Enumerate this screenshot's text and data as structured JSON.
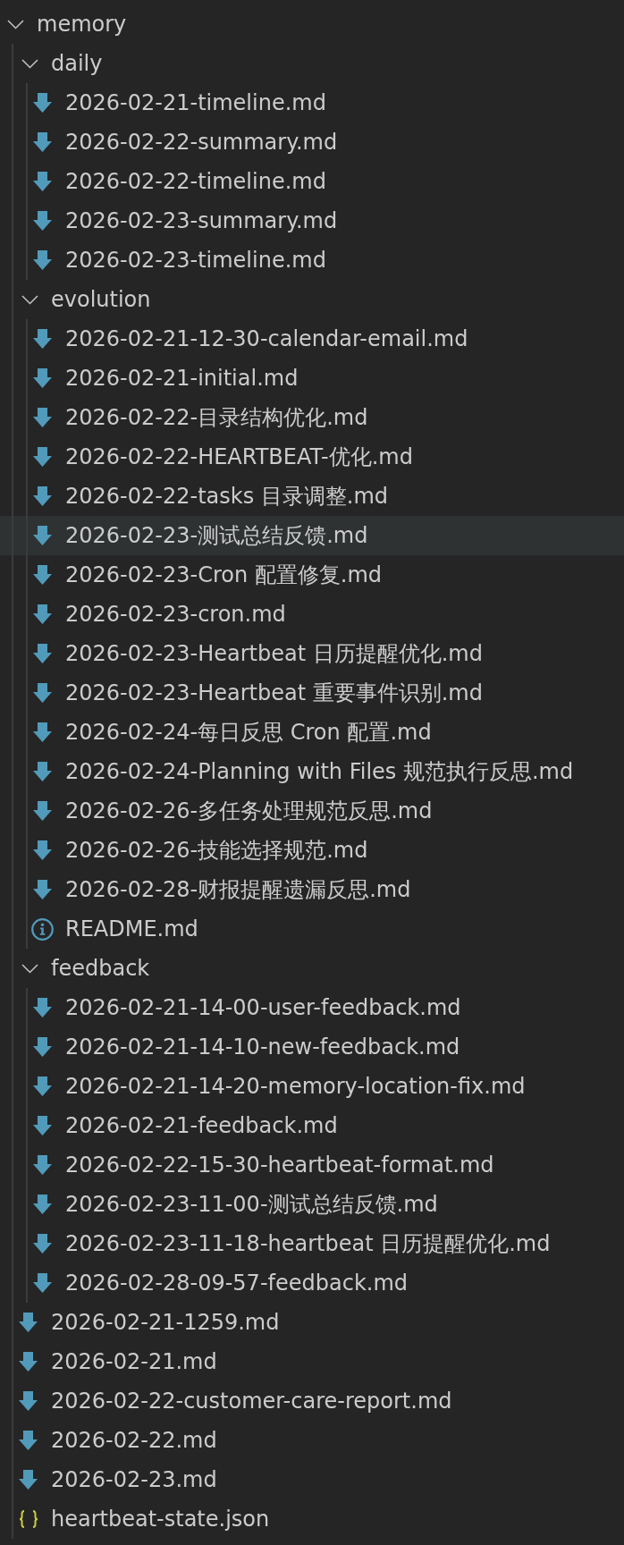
{
  "explorer": {
    "tree": [
      {
        "name": "memory",
        "kind": "folder",
        "expanded": true,
        "hovered": false,
        "children": [
          {
            "name": "daily",
            "kind": "folder",
            "expanded": true,
            "hovered": false,
            "children": [
              {
                "name": "2026-02-21-timeline.md",
                "kind": "markdown",
                "hovered": false
              },
              {
                "name": "2026-02-22-summary.md",
                "kind": "markdown",
                "hovered": false
              },
              {
                "name": "2026-02-22-timeline.md",
                "kind": "markdown",
                "hovered": false
              },
              {
                "name": "2026-02-23-summary.md",
                "kind": "markdown",
                "hovered": false
              },
              {
                "name": "2026-02-23-timeline.md",
                "kind": "markdown",
                "hovered": false
              }
            ]
          },
          {
            "name": "evolution",
            "kind": "folder",
            "expanded": true,
            "hovered": false,
            "children": [
              {
                "name": "2026-02-21-12-30-calendar-email.md",
                "kind": "markdown",
                "hovered": false
              },
              {
                "name": "2026-02-21-initial.md",
                "kind": "markdown",
                "hovered": false
              },
              {
                "name": "2026-02-22-目录结构优化.md",
                "kind": "markdown",
                "hovered": false
              },
              {
                "name": "2026-02-22-HEARTBEAT-优化.md",
                "kind": "markdown",
                "hovered": false
              },
              {
                "name": "2026-02-22-tasks 目录调整.md",
                "kind": "markdown",
                "hovered": false
              },
              {
                "name": "2026-02-23-测试总结反馈.md",
                "kind": "markdown",
                "hovered": true
              },
              {
                "name": "2026-02-23-Cron 配置修复.md",
                "kind": "markdown",
                "hovered": false
              },
              {
                "name": "2026-02-23-cron.md",
                "kind": "markdown",
                "hovered": false
              },
              {
                "name": "2026-02-23-Heartbeat 日历提醒优化.md",
                "kind": "markdown",
                "hovered": false
              },
              {
                "name": "2026-02-23-Heartbeat 重要事件识别.md",
                "kind": "markdown",
                "hovered": false
              },
              {
                "name": "2026-02-24-每日反思 Cron 配置.md",
                "kind": "markdown",
                "hovered": false
              },
              {
                "name": "2026-02-24-Planning with Files 规范执行反思.md",
                "kind": "markdown",
                "hovered": false
              },
              {
                "name": "2026-02-26-多任务处理规范反思.md",
                "kind": "markdown",
                "hovered": false
              },
              {
                "name": "2026-02-26-技能选择规范.md",
                "kind": "markdown",
                "hovered": false
              },
              {
                "name": "2026-02-28-财报提醒遗漏反思.md",
                "kind": "markdown",
                "hovered": false
              },
              {
                "name": "README.md",
                "kind": "info",
                "hovered": false
              }
            ]
          },
          {
            "name": "feedback",
            "kind": "folder",
            "expanded": true,
            "hovered": false,
            "children": [
              {
                "name": "2026-02-21-14-00-user-feedback.md",
                "kind": "markdown",
                "hovered": false
              },
              {
                "name": "2026-02-21-14-10-new-feedback.md",
                "kind": "markdown",
                "hovered": false
              },
              {
                "name": "2026-02-21-14-20-memory-location-fix.md",
                "kind": "markdown",
                "hovered": false
              },
              {
                "name": "2026-02-21-feedback.md",
                "kind": "markdown",
                "hovered": false
              },
              {
                "name": "2026-02-22-15-30-heartbeat-format.md",
                "kind": "markdown",
                "hovered": false
              },
              {
                "name": "2026-02-23-11-00-测试总结反馈.md",
                "kind": "markdown",
                "hovered": false
              },
              {
                "name": "2026-02-23-11-18-heartbeat 日历提醒优化.md",
                "kind": "markdown",
                "hovered": false
              },
              {
                "name": "2026-02-28-09-57-feedback.md",
                "kind": "markdown",
                "hovered": false
              }
            ]
          },
          {
            "name": "2026-02-21-1259.md",
            "kind": "markdown",
            "hovered": false
          },
          {
            "name": "2026-02-21.md",
            "kind": "markdown",
            "hovered": false
          },
          {
            "name": "2026-02-22-customer-care-report.md",
            "kind": "markdown",
            "hovered": false
          },
          {
            "name": "2026-02-22.md",
            "kind": "markdown",
            "hovered": false
          },
          {
            "name": "2026-02-23.md",
            "kind": "markdown",
            "hovered": false
          },
          {
            "name": "heartbeat-state.json",
            "kind": "json",
            "hovered": false
          }
        ]
      }
    ]
  }
}
